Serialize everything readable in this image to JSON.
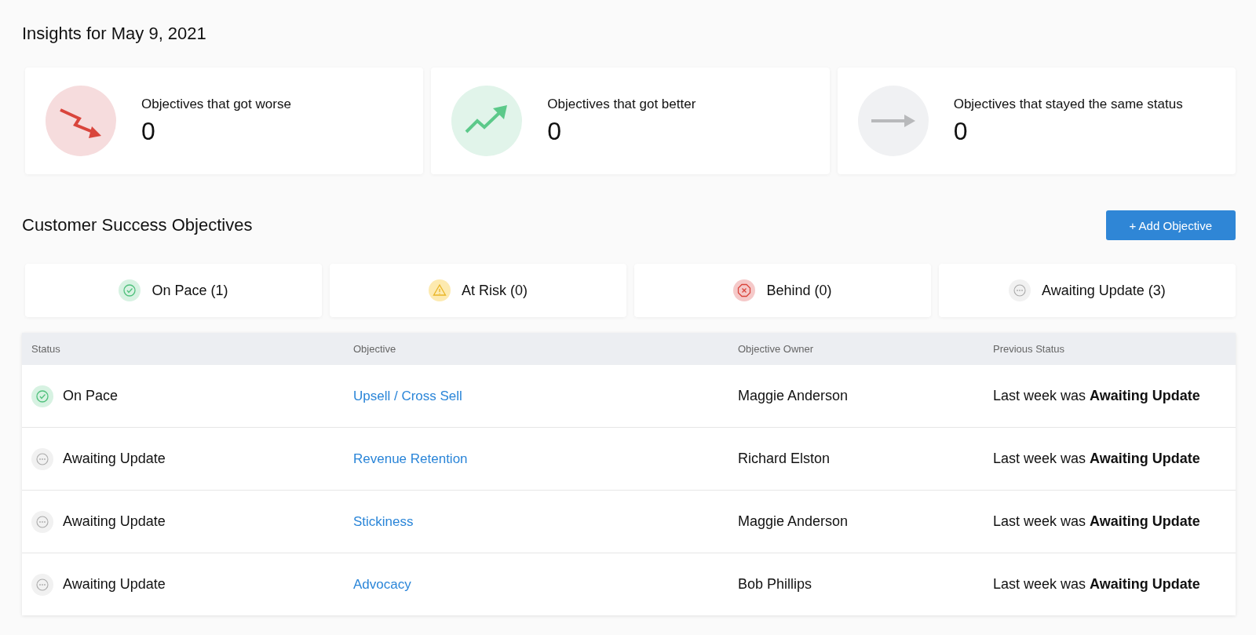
{
  "title": "Insights for May 9, 2021",
  "insights": [
    {
      "kind": "worse",
      "label": "Objectives that got worse",
      "count": "0"
    },
    {
      "kind": "better",
      "label": "Objectives that got better",
      "count": "0"
    },
    {
      "kind": "same",
      "label": "Objectives that stayed the same status",
      "count": "0"
    }
  ],
  "section_title": "Customer Success Objectives",
  "add_button": "+ Add Objective",
  "filters": [
    {
      "kind": "on_pace",
      "label": "On Pace (1)"
    },
    {
      "kind": "at_risk",
      "label": "At Risk (0)"
    },
    {
      "kind": "behind",
      "label": "Behind (0)"
    },
    {
      "kind": "awaiting",
      "label": "Awaiting Update (3)"
    }
  ],
  "table": {
    "columns": [
      "Status",
      "Objective",
      "Objective Owner",
      "Previous Status"
    ],
    "rows": [
      {
        "kind": "on_pace",
        "status": "On Pace",
        "objective": "Upsell / Cross Sell",
        "owner": "Maggie Anderson",
        "previous": "Last week was **Awaiting Update**"
      },
      {
        "kind": "awaiting",
        "status": "Awaiting Update",
        "objective": "Revenue Retention",
        "owner": "Richard Elston",
        "previous": "Last week was **Awaiting Update**"
      },
      {
        "kind": "awaiting",
        "status": "Awaiting Update",
        "objective": "Stickiness",
        "owner": "Maggie Anderson",
        "previous": "Last week was **Awaiting Update**"
      },
      {
        "kind": "awaiting",
        "status": "Awaiting Update",
        "objective": "Advocacy",
        "owner": "Bob Phillips",
        "previous": "Last week was **Awaiting Update**"
      }
    ]
  }
}
